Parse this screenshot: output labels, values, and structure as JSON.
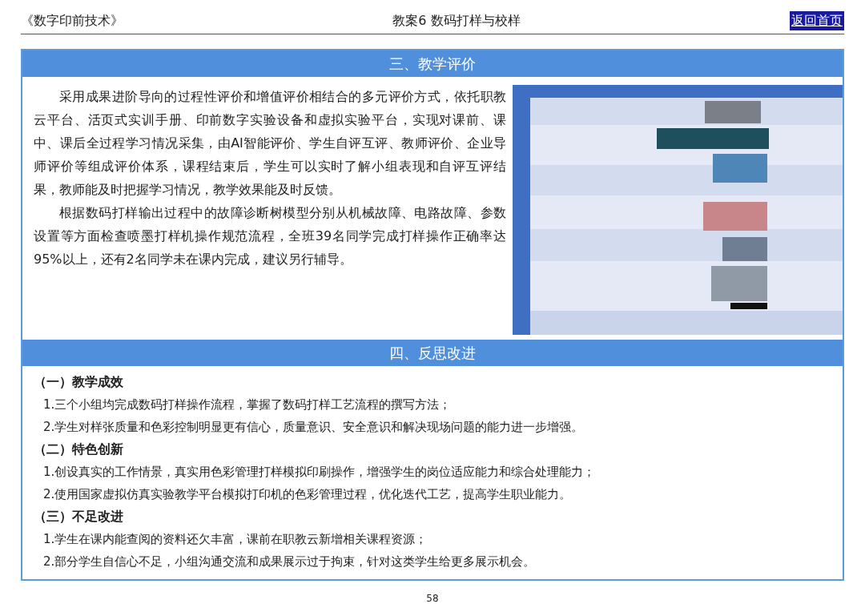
{
  "header": {
    "course": "《数字印前技术》",
    "lesson": "教案6 数码打样与校样",
    "home_link": "返回首页"
  },
  "evaluation": {
    "title": "三、教学评价",
    "paragraphs": [
      "采用成果进阶导向的过程性评价和增值评价相结合的多元评价方式，依托职教云平台、活页式实训手册、印前数字实验设备和虚拟实验平台，实现对课前、课中、课后全过程学习情况采集，由AI智能评价、学生自评互评、教师评价、企业导师评价等组成评价体系，课程结束后，学生可以实时了解小组表现和自评互评结果，教师能及时把握学习情况，教学效果能及时反馈。",
      "根据数码打样输出过程中的故障诊断树模型分别从机械故障、电路故障、参数设置等方面检查喷墨打样机操作规范流程，全班39名同学完成打样操作正确率达95%以上，还有2名同学未在课内完成，建议另行辅导。"
    ],
    "figure": {
      "kind": "picture"
    }
  },
  "reflection": {
    "title": "四、反思改进",
    "groups": [
      {
        "heading": "（一）教学成效",
        "items": [
          "1.三个小组均完成数码打样操作流程，掌握了数码打样工艺流程的撰写方法；",
          "2.学生对样张质量和色彩控制明显更有信心，质量意识、安全意识和解决现场问题的能力进一步增强。"
        ]
      },
      {
        "heading": "（二）特色创新",
        "items": [
          "1.创设真实的工作情景，真实用色彩管理打样模拟印刷操作，增强学生的岗位适应能力和综合处理能力；",
          "2.使用国家虚拟仿真实验教学平台模拟打印机的色彩管理过程，优化迭代工艺，提高学生职业能力。"
        ]
      },
      {
        "heading": "（三）不足改进",
        "items": [
          "1.学生在课内能查阅的资料还欠丰富，课前在职教云新增相关课程资源；",
          "2.部分学生自信心不足，小组沟通交流和成果展示过于拘束，针对这类学生给更多展示机会。"
        ]
      }
    ]
  },
  "page_number": "58"
}
